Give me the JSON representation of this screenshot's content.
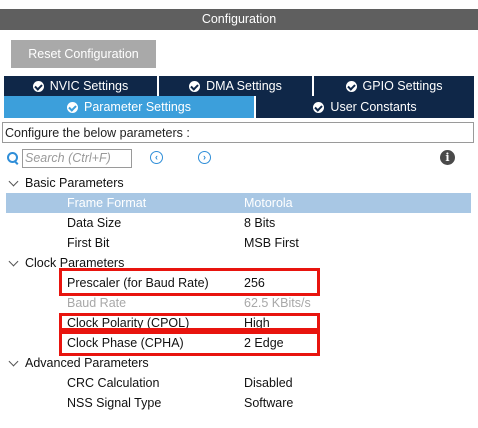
{
  "header": {
    "title": "Configuration"
  },
  "reset_button": {
    "label": "Reset Configuration"
  },
  "tabs_row1": [
    {
      "label": "NVIC Settings",
      "icon": "check-circle-icon"
    },
    {
      "label": "DMA Settings",
      "icon": "check-circle-icon"
    },
    {
      "label": "GPIO Settings",
      "icon": "check-circle-icon"
    }
  ],
  "tabs_row2": [
    {
      "label": "Parameter Settings",
      "icon": "check-circle-icon",
      "active": true
    },
    {
      "label": "User Constants",
      "icon": "check-circle-icon",
      "active": false
    }
  ],
  "configure_text": "Configure the below parameters :",
  "search": {
    "placeholder": "Search (Ctrl+F)"
  },
  "nav": {
    "prev": "‹",
    "next": "›"
  },
  "info_icon_glyph": "i",
  "groups": [
    {
      "label": "Basic Parameters",
      "params": [
        {
          "label": "Frame Format",
          "value": "Motorola"
        },
        {
          "label": "Data Size",
          "value": "8 Bits"
        },
        {
          "label": "First Bit",
          "value": "MSB First"
        }
      ]
    },
    {
      "label": "Clock Parameters",
      "params": [
        {
          "label": "Prescaler (for Baud Rate)",
          "value": "256"
        },
        {
          "label": "Baud Rate",
          "value": "62.5 KBits/s"
        },
        {
          "label": "Clock Polarity (CPOL)",
          "value": "High"
        },
        {
          "label": "Clock Phase (CPHA)",
          "value": "2 Edge"
        }
      ]
    },
    {
      "label": "Advanced Parameters",
      "params": [
        {
          "label": "CRC Calculation",
          "value": "Disabled"
        },
        {
          "label": "NSS Signal Type",
          "value": "Software"
        }
      ]
    }
  ],
  "colors": {
    "header_bg": "#5f5f5f",
    "tab_bg": "#0f2748",
    "tab_active_bg": "#3c9fdb",
    "selected_row_bg": "#a8c7e4",
    "highlight_border": "#e8140e",
    "accent": "#2f8ed8"
  }
}
